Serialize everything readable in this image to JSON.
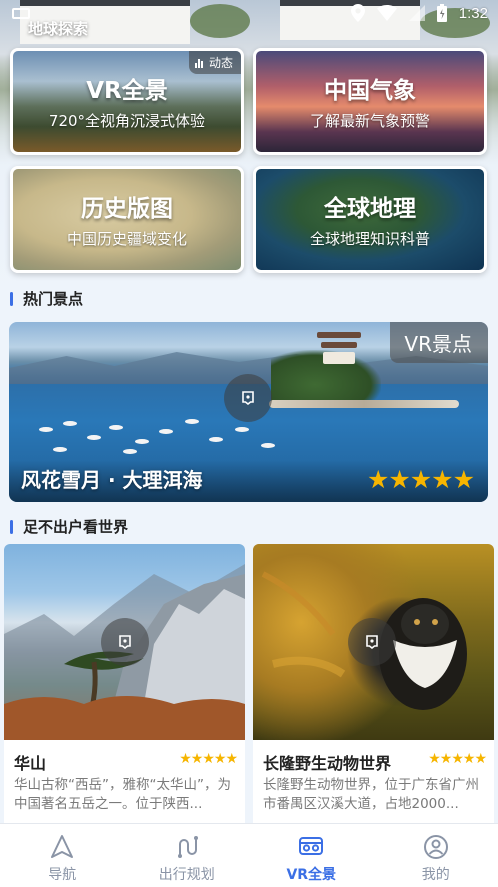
{
  "status_bar": {
    "time": "1:32"
  },
  "header": {
    "title": "地球探索"
  },
  "features": [
    {
      "title": "VR全景",
      "subtitle": "720°全视角沉浸式体验",
      "badge": "动态"
    },
    {
      "title": "中国气象",
      "subtitle": "了解最新气象预警"
    },
    {
      "title": "历史版图",
      "subtitle": "中国历史疆域变化"
    },
    {
      "title": "全球地理",
      "subtitle": "全球地理知识科普"
    }
  ],
  "hot_spots": {
    "heading": "热门景点",
    "banner": {
      "tag": "VR景点",
      "title": "风花雪月 · 大理洱海",
      "rating": 5,
      "stars": "★★★★★"
    }
  },
  "world": {
    "heading": "足不出户看世界",
    "cards": [
      {
        "name": "华山",
        "stars": "★★★★★",
        "rating": 5,
        "desc": "华山古称“西岳”，雅称“太华山”，为中国著名五岳之一。位于陕西..."
      },
      {
        "name": "长隆野生动物世界",
        "stars": "★★★★★",
        "rating": 5,
        "desc": "长隆野生动物世界，位于广东省广州市番禺区汉溪大道，占地2000..."
      }
    ]
  },
  "tabbar": {
    "items": [
      {
        "label": "导航",
        "icon": "navigation-arrow-icon",
        "active": false
      },
      {
        "label": "出行规划",
        "icon": "route-icon",
        "active": false
      },
      {
        "label": "VR全景",
        "icon": "vr-glasses-icon",
        "active": true
      },
      {
        "label": "我的",
        "icon": "user-icon",
        "active": false
      }
    ]
  },
  "colors": {
    "accent": "#3b6fe5",
    "star": "#f6b500",
    "inactive": "#8a94a6"
  }
}
